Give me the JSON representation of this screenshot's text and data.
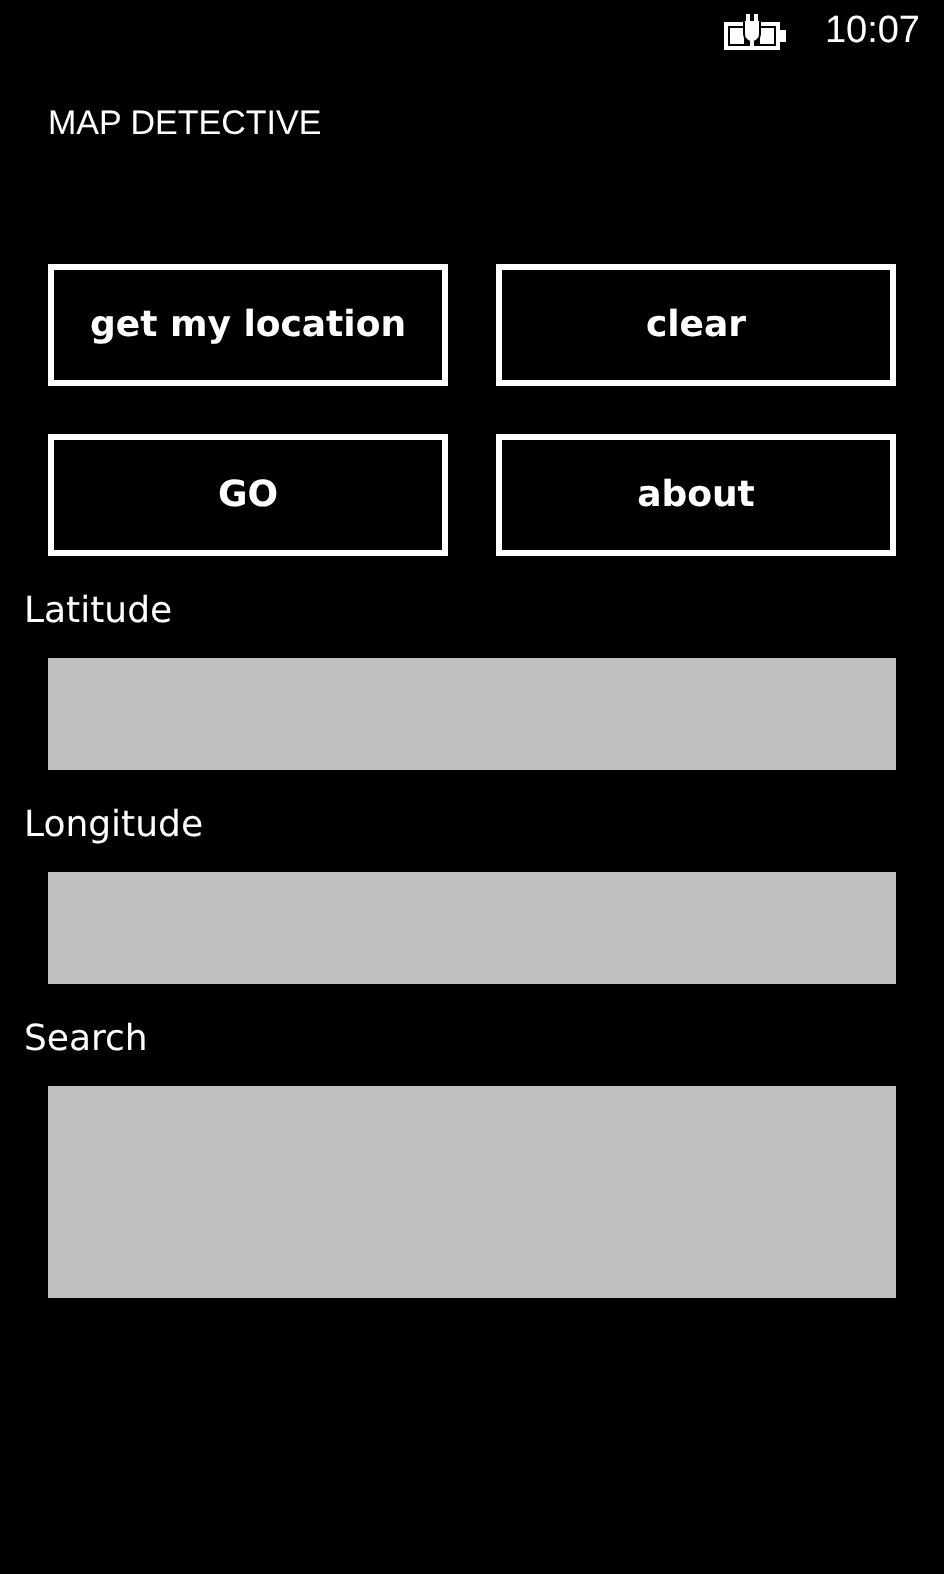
{
  "status_bar": {
    "time": "10:07"
  },
  "app_title": "MAP DETECTIVE",
  "buttons": [
    "get my location",
    "clear",
    "GO",
    "about"
  ],
  "fields": [
    {
      "label": "Latitude",
      "kind": "line"
    },
    {
      "label": "Longitude",
      "kind": "line"
    },
    {
      "label": "Search",
      "kind": "box"
    }
  ]
}
